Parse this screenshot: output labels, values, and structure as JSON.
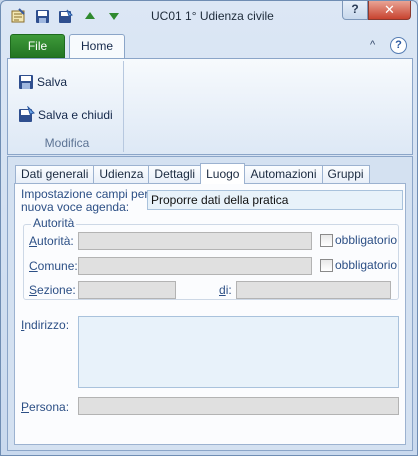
{
  "window": {
    "title": "UC01 1° Udienza civile",
    "help_label": "?",
    "close_label": "✕"
  },
  "ribbon": {
    "tabs": [
      "File",
      "Home"
    ],
    "minimize_label": "^",
    "help_label": "?",
    "buttons": {
      "save_label": "Salva",
      "save_close_label": "Salva e chiudi"
    },
    "group_label": "Modifica"
  },
  "form_tabs": [
    "Dati generali",
    "Udienza",
    "Dettagli",
    "Luogo",
    "Automazioni",
    "Gruppi"
  ],
  "active_tab": "Luogo",
  "form": {
    "agenda_label_1": "Impostazione campi per",
    "agenda_label_2": "nuova voce agenda:",
    "agenda_value": "Proporre dati della pratica",
    "group_title": "Autorità",
    "autorita_label": "Autorità:",
    "comune_label": "Comune:",
    "sezione_label": "Sezione:",
    "di_label": "di:",
    "obbligatorio_label": "obbligatorio",
    "indirizzo_label": "Indirizzo:",
    "persona_label": "Persona:"
  }
}
